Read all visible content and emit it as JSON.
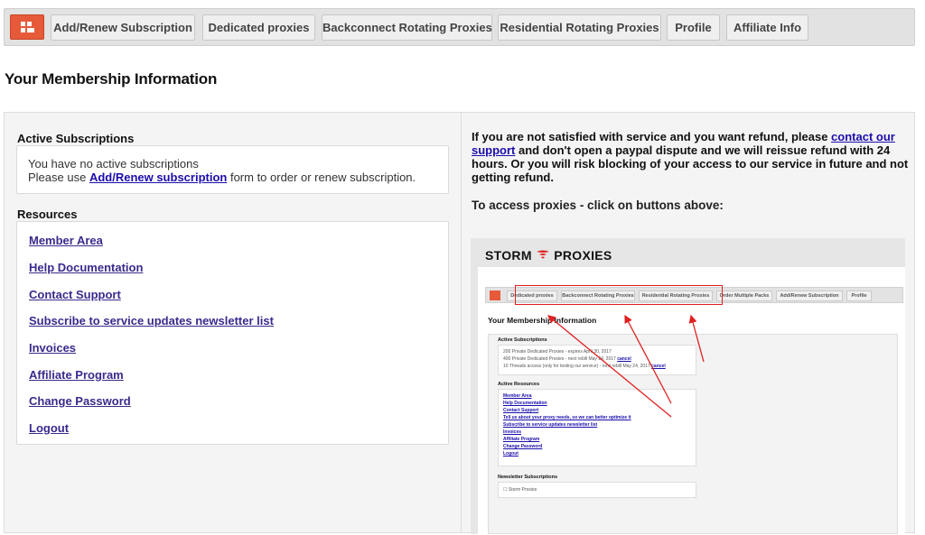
{
  "topnav": {
    "home_icon": "dashboard-icon",
    "tabs": [
      {
        "label": "Add/Renew Subscription"
      },
      {
        "label": "Dedicated proxies"
      },
      {
        "label": "Backconnect Rotating Proxies"
      },
      {
        "label": "Residential Rotating Proxies"
      },
      {
        "label": "Profile"
      },
      {
        "label": "Affiliate Info"
      }
    ]
  },
  "page_title": "Your Membership Information",
  "active_subscriptions": {
    "title": "Active Subscriptions",
    "line1": "You have no active subscriptions",
    "line2_prefix": "Please use ",
    "line2_link": "Add/Renew subscription",
    "line2_suffix": " form to order or renew subscription."
  },
  "resources": {
    "title": "Resources",
    "links": [
      "Member Area",
      "Help Documentation",
      "Contact Support",
      "Subscribe to service updates newsletter list",
      "Invoices",
      "Affiliate Program",
      "Change Password",
      "Logout"
    ]
  },
  "refund_notice": {
    "prefix": "If you are not satisfied with service and you want refund, please ",
    "link": "contact our support",
    "suffix": " and don't open a paypal dispute and we will reissue refund with 24 hours. Or you will risk blocking of your access to our service in future and not getting refund."
  },
  "access_title": "To access proxies - click on buttons above:",
  "screenshot": {
    "logo_left": "STORM",
    "logo_right": "PROXIES",
    "tabs": [
      "Dedicated proxies",
      "Backconnect Rotating Proxies",
      "Residential Rotating Proxies",
      "Order Multiple Packs",
      "Add/Renew Subscription",
      "Profile"
    ],
    "title": "Your Membership Information",
    "active_subs_title": "Active Subscriptions",
    "subs_lines": [
      "200 Private Dedicated Proxies - expires April 30, 2017",
      "400 Private Dedicated Proxies - next rebill May 24, 2017",
      "10 Threads access (only for testing our service) - next rebill May 24, 2017"
    ],
    "cancel_label": "cancel",
    "active_resources_title": "Active Resources",
    "resource_links": [
      "Member Area",
      "Help Documentation",
      "Contact Support",
      "Tell us about your proxy needs, so we can better optimize it",
      "Subscribe to service updates newsletter list",
      "Invoices",
      "Affiliate Program",
      "Change Password",
      "Logout"
    ],
    "newsletter_title": "Newsletter Subscriptions",
    "newsletter_item": "Storm Proxies"
  },
  "colors": {
    "accent": "#e65a3a",
    "link": "#1a0dab",
    "annotation": "#e02020"
  }
}
